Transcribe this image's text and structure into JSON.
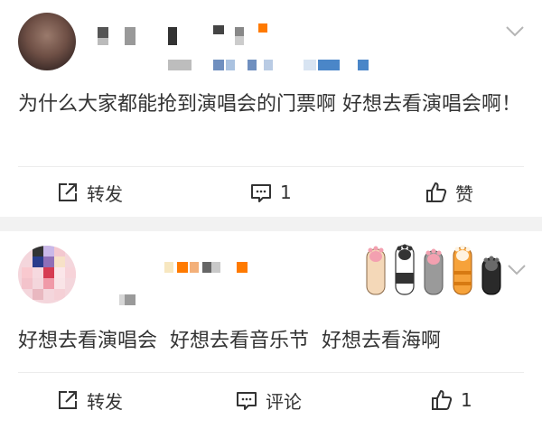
{
  "posts": [
    {
      "content": "为什么大家都能抢到演唱会的门票啊 好想去看演唱会啊！",
      "actions": {
        "repost": "转发",
        "comment": "1",
        "like": "赞"
      }
    },
    {
      "content": "好想去看演唱会  好想去看音乐节  好想去看海啊",
      "actions": {
        "repost": "转发",
        "comment": "评论",
        "like": "1"
      }
    }
  ],
  "icons": {
    "expand": "chevron-down-icon",
    "repost": "share-square-icon",
    "comment": "chat-bubble-icon",
    "like": "thumbs-up-icon",
    "decoration": "cat-paws-icon"
  },
  "colors": {
    "page_bg": "#f2f2f2",
    "card_bg": "#ffffff",
    "text": "#333333",
    "accent_orange": "#ff7a00",
    "accent_blue": "#4a86c8"
  }
}
